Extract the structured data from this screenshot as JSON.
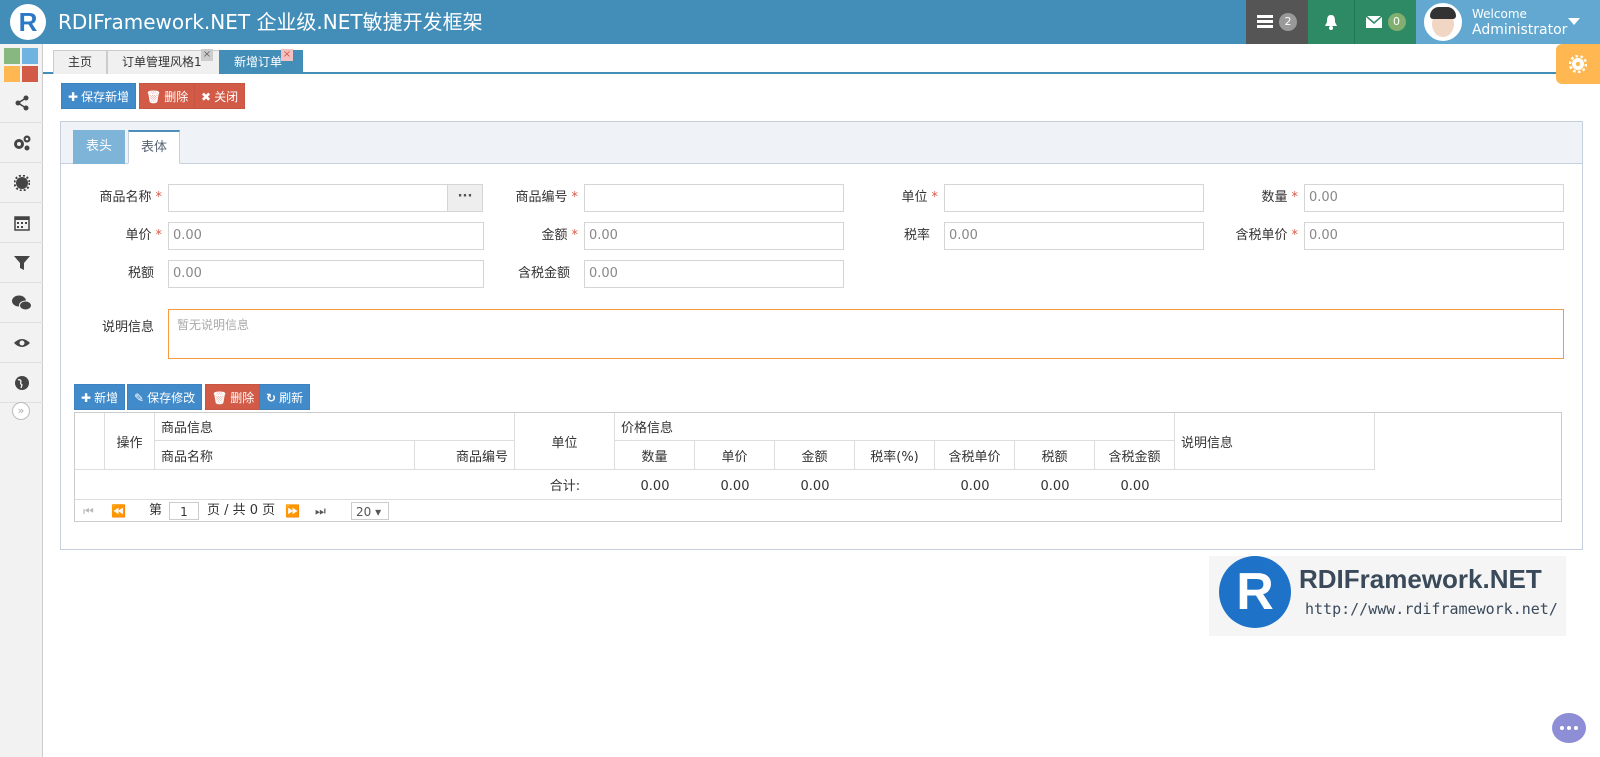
{
  "header": {
    "logo_letter": "R",
    "title": "RDIFramework.NET 企业级.NET敏捷开发框架",
    "tasks_count": "2",
    "mail_count": "0",
    "welcome": "Welcome",
    "username": "Administrator"
  },
  "sidebar": {
    "items": [
      "share-icon",
      "cogs-icon",
      "gear-icon",
      "calendar-icon",
      "filter-icon",
      "wechat-icon",
      "eye-icon",
      "globe-icon"
    ],
    "collapse": "»"
  },
  "tabs": [
    {
      "label": "主页"
    },
    {
      "label": "订单管理风格1"
    },
    {
      "label": "新增订单"
    }
  ],
  "toolbar": {
    "save_new": "保存新增",
    "delete": "删除",
    "close": "关闭"
  },
  "panel_tabs": [
    "表头",
    "表体"
  ],
  "form": {
    "product_name": {
      "label": "商品名称",
      "value": ""
    },
    "product_code": {
      "label": "商品编号",
      "value": ""
    },
    "unit": {
      "label": "单位",
      "value": ""
    },
    "quantity": {
      "label": "数量",
      "value": "0.00"
    },
    "unit_price": {
      "label": "单价",
      "value": "0.00"
    },
    "amount": {
      "label": "金额",
      "value": "0.00"
    },
    "tax_rate": {
      "label": "税率",
      "value": "0.00"
    },
    "tax_incl_price": {
      "label": "含税单价",
      "value": "0.00"
    },
    "tax_amount": {
      "label": "税额",
      "value": "0.00"
    },
    "tax_incl_amount": {
      "label": "含税金额",
      "value": "0.00"
    },
    "description": {
      "label": "说明信息",
      "placeholder": "暂无说明信息"
    }
  },
  "grid_toolbar": {
    "add": "新增",
    "save_edit": "保存修改",
    "delete": "删除",
    "refresh": "刷新"
  },
  "grid": {
    "group_headers": {
      "action": "操作",
      "product_info": "商品信息",
      "unit": "单位",
      "price_info": "价格信息",
      "remark": "说明信息"
    },
    "columns": {
      "product_name": "商品名称",
      "product_code": "商品编号",
      "quantity": "数量",
      "unit_price": "单价",
      "amount": "金额",
      "tax_rate": "税率(%)",
      "tax_incl_price": "含税单价",
      "tax": "税额",
      "tax_incl_amount": "含税金额"
    },
    "footer": {
      "label": "合计:",
      "quantity": "0.00",
      "unit_price": "0.00",
      "amount": "0.00",
      "tax_incl_price": "0.00",
      "tax": "0.00",
      "tax_incl_amount": "0.00"
    },
    "pager": {
      "page_prefix": "第",
      "page_value": "1",
      "page_suffix": "页 / 共 0 页",
      "page_size": "20"
    }
  },
  "brand": {
    "title": "RDIFramework.NET",
    "url": "http://www.rdiframework.net/"
  },
  "colors": {
    "header": "#438eb9",
    "primary": "#428bca",
    "danger": "#d15b47",
    "success": "#2e8965",
    "warning": "#ffb752"
  }
}
